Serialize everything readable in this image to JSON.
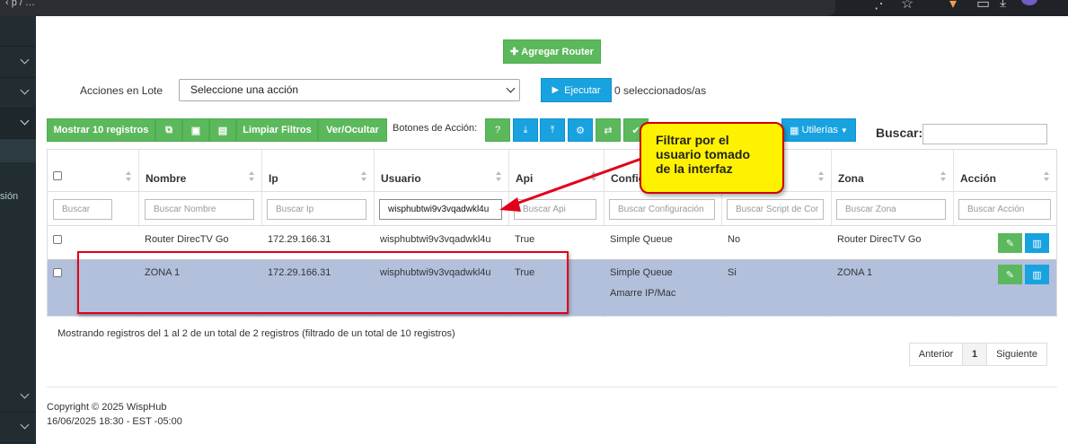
{
  "colors": {
    "green": "#5cb85c",
    "blue": "#18a2e0",
    "selected_row": "#b3c0dc",
    "callout_bg": "#fff200",
    "highlight_border": "#e0001a"
  },
  "browser": {
    "url_text": "‹ p / …"
  },
  "sidebar": {
    "partial_text": "sión"
  },
  "toolbar": {
    "add_router": "Agregar Router",
    "batch_label": "Acciones en Lote",
    "batch_select": "Seleccione una acción",
    "execute": "Ejecutar",
    "selected_count": "0 seleccionados/as",
    "show_records": "Mostrar 10 registros",
    "clear_filters": "Limpiar Filtros",
    "show_hide": "Ver/Ocultar",
    "action_buttons_label": "Botones de Acción:",
    "utilities": "Utilerías",
    "search_label": "Buscar:"
  },
  "table": {
    "headers": [
      "Nombre",
      "Ip",
      "Usuario",
      "Api",
      "Config",
      "",
      "Zona",
      "Acción"
    ],
    "placeholders": [
      "Buscar",
      "Buscar Nombre",
      "Buscar Ip",
      "wisphubtwi9v3vqadwkl4u",
      "Buscar Api",
      "Buscar Configuración",
      "Buscar Script de Cor",
      "Buscar Zona",
      "Buscar Acción"
    ],
    "rows": [
      {
        "nombre": "Router DirecTV Go",
        "ip": "172.29.166.31",
        "usuario": "wisphubtwi9v3vqadwkl4u",
        "api": "True",
        "config": "Simple Queue",
        "config2": "",
        "script": "No",
        "zona": "Router DirecTV Go"
      },
      {
        "nombre": "ZONA 1",
        "ip": "172.29.166.31",
        "usuario": "wisphubtwi9v3vqadwkl4u",
        "api": "True",
        "config": "Simple Queue",
        "config2": "Amarre IP/Mac",
        "script": "Si",
        "zona": "ZONA 1"
      }
    ]
  },
  "info": "Mostrando registros del 1 al 2 de un total de 2 registros (filtrado de un total de 10 registros)",
  "pagination": {
    "prev": "Anterior",
    "page": "1",
    "next": "Siguiente"
  },
  "footer": {
    "copyright": "Copyright © 2025 WispHub",
    "datetime": "16/06/2025 18:30 - EST -05:00"
  },
  "callout": {
    "line1": "Filtrar por el",
    "line2": "usuario tomado",
    "line3": "de la interfaz"
  }
}
